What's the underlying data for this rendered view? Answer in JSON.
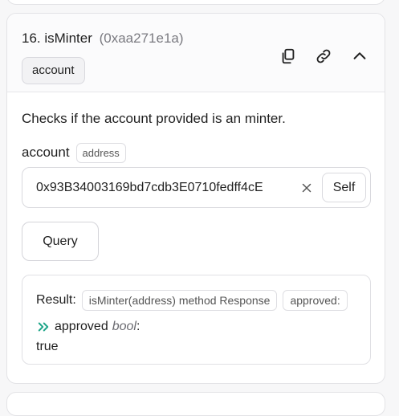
{
  "function": {
    "title": "16. isMinter",
    "selector": "(0xaa271e1a)",
    "tag": "account",
    "description": "Checks if the account provided is an minter."
  },
  "header_icons": [
    "copy-icon",
    "link-icon",
    "chevron-up-icon"
  ],
  "param": {
    "name": "account",
    "type": "address",
    "value": "0x93B34003169bd7cdb3E0710fedff4cE",
    "self_label": "Self"
  },
  "query_label": "Query",
  "result": {
    "label": "Result:",
    "method_tag": "isMinter(address) method Response",
    "field_tag": "approved:",
    "output_name": "approved",
    "output_type": "bool",
    "output_colon": ":",
    "output_value": "true"
  },
  "colors": {
    "accent_chevron": "#20a68a",
    "border": "#e3e3e6"
  }
}
